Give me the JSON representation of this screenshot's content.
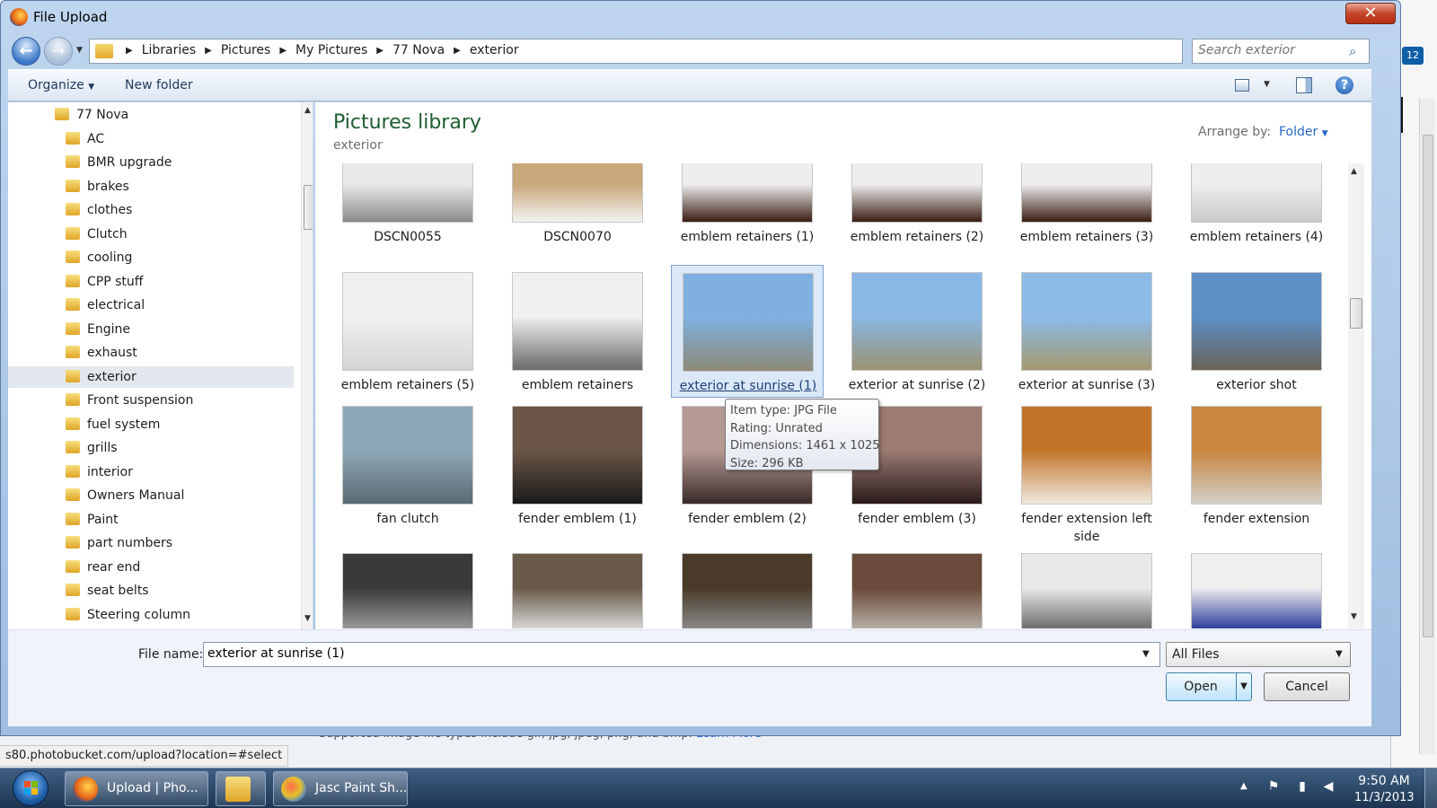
{
  "window": {
    "title": "File Upload"
  },
  "address": {
    "crumbs": [
      "Libraries",
      "Pictures",
      "My Pictures",
      "77 Nova",
      "exterior"
    ],
    "search_placeholder": "Search exterior"
  },
  "toolbar": {
    "organize_label": "Organize",
    "new_folder_label": "New folder",
    "help_label": "?"
  },
  "nav": {
    "items": [
      {
        "label": "77 Nova",
        "level": 0
      },
      {
        "label": "AC",
        "level": 1
      },
      {
        "label": "BMR upgrade",
        "level": 1
      },
      {
        "label": "brakes",
        "level": 1
      },
      {
        "label": "clothes",
        "level": 1
      },
      {
        "label": "Clutch",
        "level": 1
      },
      {
        "label": "cooling",
        "level": 1
      },
      {
        "label": "CPP stuff",
        "level": 1
      },
      {
        "label": "electrical",
        "level": 1
      },
      {
        "label": "Engine",
        "level": 1
      },
      {
        "label": "exhaust",
        "level": 1
      },
      {
        "label": "exterior",
        "level": 1,
        "selected": true
      },
      {
        "label": "Front suspension",
        "level": 1
      },
      {
        "label": "fuel system",
        "level": 1
      },
      {
        "label": "grills",
        "level": 1
      },
      {
        "label": "interior",
        "level": 1
      },
      {
        "label": "Owners Manual",
        "level": 1
      },
      {
        "label": "Paint",
        "level": 1
      },
      {
        "label": "part numbers",
        "level": 1
      },
      {
        "label": "rear end",
        "level": 1
      },
      {
        "label": "seat belts",
        "level": 1
      },
      {
        "label": "Steering column",
        "level": 1
      }
    ]
  },
  "content": {
    "library_title": "Pictures library",
    "library_subtitle": "exterior",
    "arrange_label": "Arrange by:",
    "arrange_value": "Folder",
    "files": [
      {
        "name": "DSCN0055",
        "thumb": [
          "#e9e9e9",
          "#8a8a8a"
        ]
      },
      {
        "name": "DSCN0070",
        "thumb": [
          "#c9a77a",
          "#f2f2f2"
        ]
      },
      {
        "name": "emblem retainers (1)",
        "thumb": [
          "#eeeeee",
          "#3a1e12"
        ]
      },
      {
        "name": "emblem retainers (2)",
        "thumb": [
          "#eeeeee",
          "#3a1e12"
        ]
      },
      {
        "name": "emblem retainers (3)",
        "thumb": [
          "#eeeeee",
          "#3a1e12"
        ]
      },
      {
        "name": "emblem retainers (4)",
        "thumb": [
          "#eeeeee",
          "#c9c9c9"
        ]
      },
      {
        "name": "emblem retainers (5)",
        "thumb": [
          "#f0f0f0",
          "#d4d4d4"
        ]
      },
      {
        "name": "emblem retainers",
        "thumb": [
          "#f0f0f0",
          "#6a6a6a"
        ]
      },
      {
        "name": "exterior at sunrise (1)",
        "thumb": [
          "#7fb0e0",
          "#8c8a78"
        ],
        "selected": true
      },
      {
        "name": "exterior at sunrise (2)",
        "thumb": [
          "#8ab8e6",
          "#9b9272"
        ]
      },
      {
        "name": "exterior at sunrise (3)",
        "thumb": [
          "#8cbbe8",
          "#a39870"
        ]
      },
      {
        "name": "exterior shot",
        "thumb": [
          "#5d8fc7",
          "#6a6258"
        ]
      },
      {
        "name": "fan clutch",
        "thumb": [
          "#8fa8b8",
          "#5a6a72"
        ]
      },
      {
        "name": "fender emblem (1)",
        "thumb": [
          "#6b5647",
          "#1a1a1a"
        ]
      },
      {
        "name": "fender emblem (2)",
        "thumb": [
          "#b59a93",
          "#3a2a2a"
        ]
      },
      {
        "name": "fender emblem (3)",
        "thumb": [
          "#9b7b73",
          "#2a1a1a"
        ]
      },
      {
        "name": "fender extension left side",
        "thumb": [
          "#c2752a",
          "#efe9de"
        ]
      },
      {
        "name": "fender extension",
        "thumb": [
          "#c8863f",
          "#d4d0cc"
        ]
      },
      {
        "name": "",
        "thumb": [
          "#3a3a3a",
          "#9a9a9a"
        ]
      },
      {
        "name": "",
        "thumb": [
          "#6a5a4a",
          "#d8d8d8"
        ]
      },
      {
        "name": "",
        "thumb": [
          "#4a3a2a",
          "#8a8a8a"
        ]
      },
      {
        "name": "",
        "thumb": [
          "#6a4a3a",
          "#b8b0a8"
        ]
      },
      {
        "name": "",
        "thumb": [
          "#e9e9e9",
          "#6a6a6a"
        ]
      },
      {
        "name": "",
        "thumb": [
          "#efefef",
          "#2a3a9a"
        ]
      }
    ]
  },
  "tooltip": {
    "lines": [
      "Item type: JPG File",
      "Rating: Unrated",
      "Dimensions: 1461 x 1025",
      "Size: 296 KB"
    ]
  },
  "bottom": {
    "filename_label": "File name:",
    "filename_value": "exterior at sunrise (1)",
    "filter_value": "All Files",
    "open_label": "Open",
    "cancel_label": "Cancel"
  },
  "browser": {
    "status_url": "s80.photobucket.com/upload?location=#select",
    "supported_text": "Supported image file types include gif, jpg, jpeg, png, and bmp.",
    "learn_more": "Learn More",
    "notification_badge": "12"
  },
  "taskbar": {
    "items": [
      "Upload | Pho...",
      "",
      "Jasc Paint Sh..."
    ],
    "clock_time": "9:50 AM",
    "clock_date": "11/3/2013"
  },
  "colors": {
    "accent": "#2a67c4",
    "library_title": "#1e5d32",
    "selection": "#dbe8f8"
  }
}
